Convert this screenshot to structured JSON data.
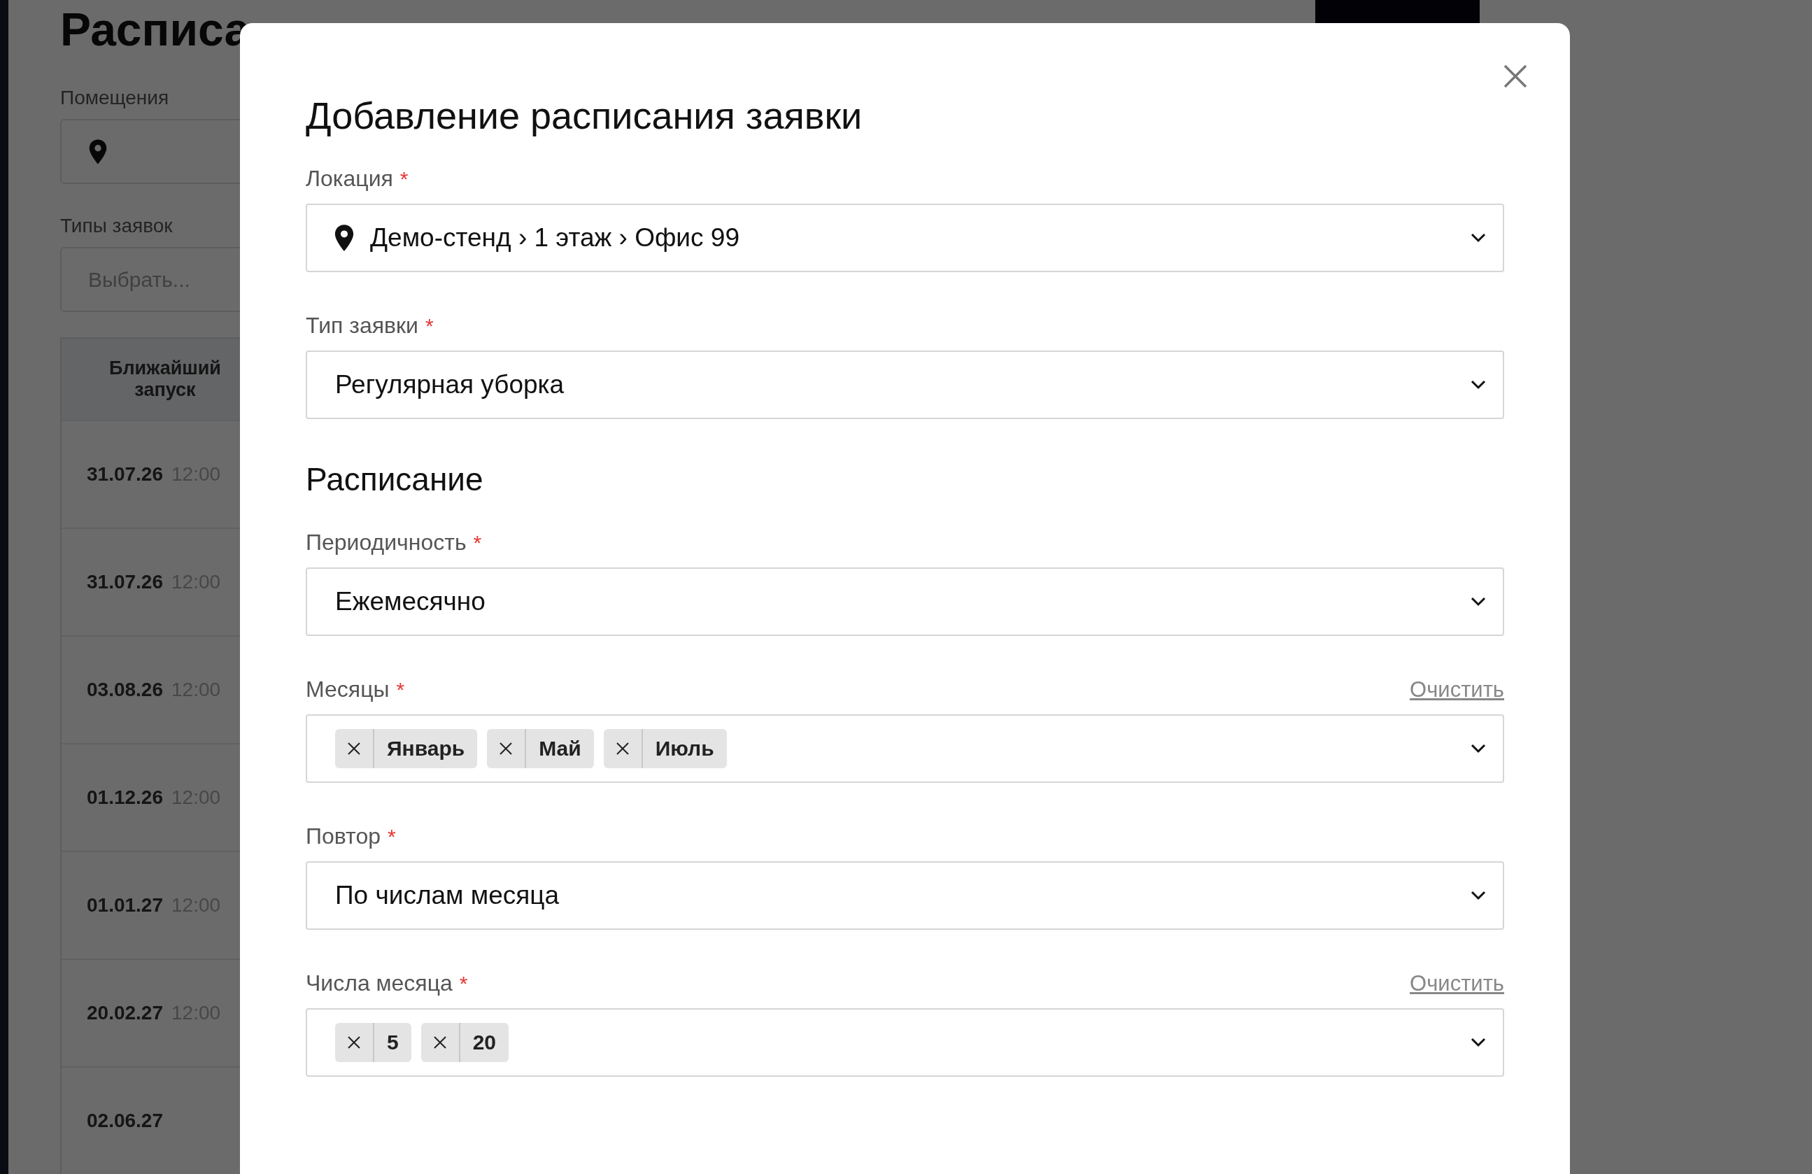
{
  "background": {
    "title": "Расписа",
    "rooms_label": "Помещения",
    "types_label": "Типы заявок",
    "types_placeholder": "Выбрать...",
    "table_header": "Ближайший запуск",
    "rows": [
      {
        "date": "31.07.26",
        "time": "12:00"
      },
      {
        "date": "31.07.26",
        "time": "12:00"
      },
      {
        "date": "03.08.26",
        "time": "12:00"
      },
      {
        "date": "01.12.26",
        "time": "12:00"
      },
      {
        "date": "01.01.27",
        "time": "12:00"
      },
      {
        "date": "20.02.27",
        "time": "12:00"
      },
      {
        "date": "02.06.27"
      }
    ]
  },
  "dialog": {
    "title": "Добавление расписания заявки",
    "fields": [
      {
        "kind": "location",
        "label": "Локация",
        "required_mark": "*",
        "value": "Демо-стенд › 1 этаж › Офис 99"
      },
      {
        "kind": "select",
        "label": "Тип заявки",
        "required_mark": "*",
        "value": "Регулярная уборка"
      },
      {
        "kind": "heading",
        "text": "Расписание"
      },
      {
        "kind": "select",
        "label": "Периодичность",
        "required_mark": "*",
        "value": "Ежемесячно"
      },
      {
        "kind": "tags",
        "label": "Месяцы",
        "required_mark": "*",
        "clear": "Очистить",
        "tags": [
          "Январь",
          "Май",
          "Июль"
        ]
      },
      {
        "kind": "select",
        "label": "Повтор",
        "required_mark": "*",
        "value": "По числам месяца"
      },
      {
        "kind": "tags",
        "label": "Числа месяца",
        "required_mark": "*",
        "clear": "Очистить",
        "tags": [
          "5",
          "20"
        ]
      }
    ]
  }
}
